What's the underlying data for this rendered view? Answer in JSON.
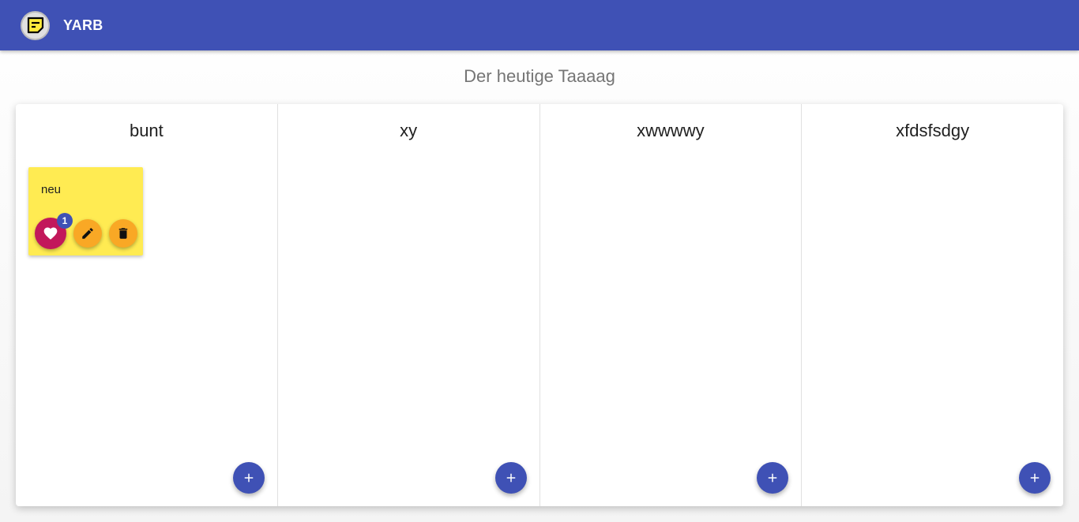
{
  "app": {
    "title": "YARB",
    "logo_icon": "note-icon"
  },
  "board": {
    "title": "Der heutige Taaaag"
  },
  "columns": [
    {
      "title": "bunt",
      "add_icon": "plus-icon"
    },
    {
      "title": "xy",
      "add_icon": "plus-icon"
    },
    {
      "title": "xwwwwy",
      "add_icon": "plus-icon"
    },
    {
      "title": "xfdsfsdgy",
      "add_icon": "plus-icon"
    }
  ],
  "notes": [
    {
      "column": "bunt",
      "text": "neu",
      "likes": "1",
      "color": "#ffeb52"
    }
  ],
  "colors": {
    "primary": "#3f51b5",
    "like": "#c2185b",
    "action": "#f9a825",
    "note": "#ffeb52"
  }
}
